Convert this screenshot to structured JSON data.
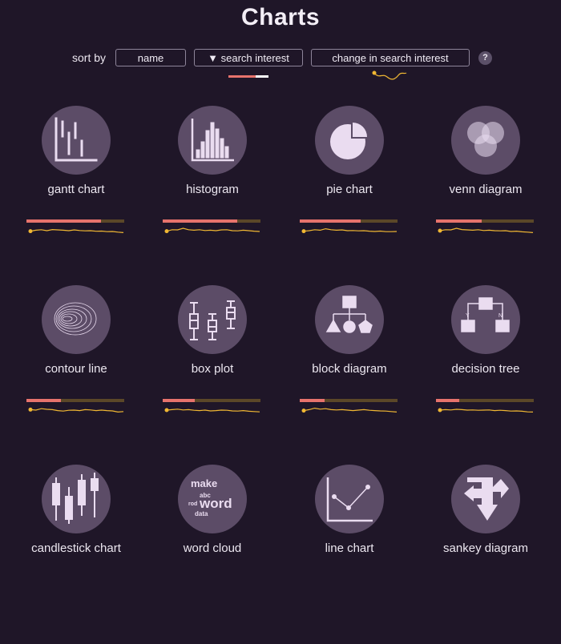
{
  "page": {
    "title": "Charts"
  },
  "sort": {
    "label": "sort by",
    "options": [
      "name",
      "▼ search interest",
      "change in search interest"
    ],
    "help": "?"
  },
  "colors": {
    "background": "#1f1628",
    "circle": "#5c4c67",
    "icon": "#eadcf0",
    "interest_bar": "#e7736c",
    "bar_track": "#5b4728",
    "sparkline": "#f0b733"
  },
  "charts": [
    {
      "label": "gantt chart",
      "icon": "gantt-chart-icon",
      "interest": 0.76,
      "trend": [
        0.45,
        0.55,
        0.6,
        0.5,
        0.62,
        0.58,
        0.55,
        0.5,
        0.58,
        0.52,
        0.48,
        0.5,
        0.44,
        0.46,
        0.4,
        0.42,
        0.35,
        0.3
      ]
    },
    {
      "label": "histogram",
      "icon": "histogram-icon",
      "interest": 0.76,
      "trend": [
        0.45,
        0.6,
        0.58,
        0.75,
        0.6,
        0.55,
        0.6,
        0.52,
        0.55,
        0.5,
        0.58,
        0.6,
        0.5,
        0.48,
        0.55,
        0.5,
        0.45,
        0.42
      ]
    },
    {
      "label": "pie chart",
      "icon": "pie-chart-icon",
      "interest": 0.62,
      "trend": [
        0.45,
        0.5,
        0.6,
        0.55,
        0.7,
        0.6,
        0.55,
        0.58,
        0.5,
        0.52,
        0.48,
        0.5,
        0.45,
        0.42,
        0.46,
        0.4,
        0.4,
        0.42
      ]
    },
    {
      "label": "venn diagram",
      "icon": "venn-diagram-icon",
      "interest": 0.47,
      "trend": [
        0.5,
        0.6,
        0.58,
        0.75,
        0.62,
        0.58,
        0.55,
        0.6,
        0.52,
        0.55,
        0.5,
        0.48,
        0.5,
        0.42,
        0.45,
        0.38,
        0.35,
        0.3
      ]
    },
    {
      "label": "contour line",
      "icon": "contour-line-icon",
      "interest": 0.35,
      "trend": [
        0.55,
        0.5,
        0.65,
        0.58,
        0.55,
        0.45,
        0.4,
        0.48,
        0.5,
        0.45,
        0.55,
        0.52,
        0.45,
        0.5,
        0.45,
        0.42,
        0.3,
        0.35
      ]
    },
    {
      "label": "box plot",
      "icon": "box-plot-icon",
      "interest": 0.33,
      "trend": [
        0.5,
        0.55,
        0.6,
        0.52,
        0.55,
        0.48,
        0.45,
        0.5,
        0.42,
        0.45,
        0.5,
        0.48,
        0.42,
        0.4,
        0.45,
        0.38,
        0.35,
        0.32
      ]
    },
    {
      "label": "block diagram",
      "icon": "block-diagram-icon",
      "interest": 0.25,
      "trend": [
        0.45,
        0.55,
        0.7,
        0.6,
        0.65,
        0.55,
        0.52,
        0.55,
        0.5,
        0.45,
        0.5,
        0.55,
        0.48,
        0.45,
        0.42,
        0.4,
        0.35,
        0.3
      ]
    },
    {
      "label": "decision tree",
      "icon": "decision-tree-icon",
      "interest": 0.24,
      "trend": [
        0.5,
        0.55,
        0.52,
        0.58,
        0.55,
        0.5,
        0.52,
        0.48,
        0.5,
        0.52,
        0.45,
        0.48,
        0.45,
        0.4,
        0.42,
        0.38,
        0.32,
        0.3
      ]
    },
    {
      "label": "candlestick chart",
      "icon": "candlestick-chart-icon",
      "interest": null,
      "trend": []
    },
    {
      "label": "word cloud",
      "icon": "word-cloud-icon",
      "interest": null,
      "trend": [],
      "icon_text": [
        "make",
        "abc",
        "rod",
        "word",
        "data"
      ]
    },
    {
      "label": "line chart",
      "icon": "line-chart-icon",
      "interest": null,
      "trend": []
    },
    {
      "label": "sankey diagram",
      "icon": "sankey-diagram-icon",
      "interest": null,
      "trend": []
    }
  ]
}
